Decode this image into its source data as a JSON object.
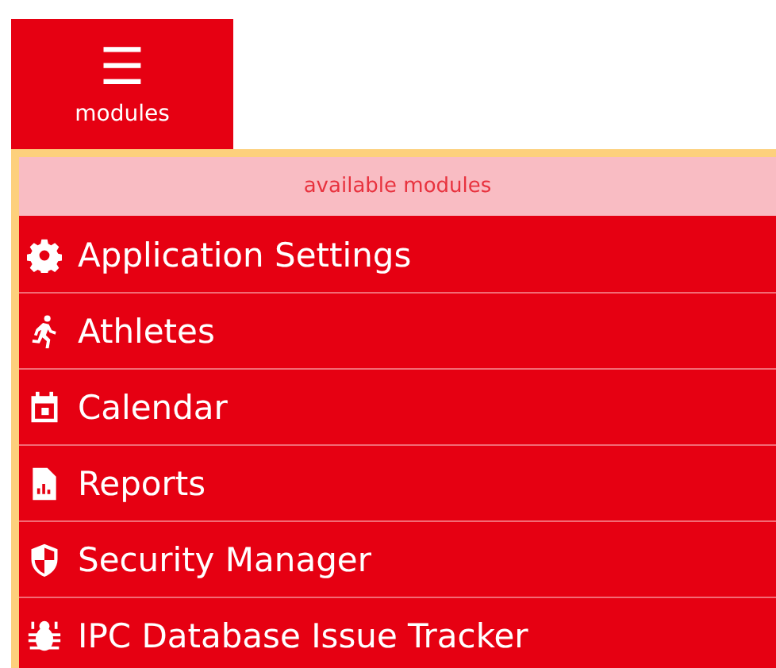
{
  "menu_button": {
    "icon": "☰",
    "label": "modules"
  },
  "panel": {
    "heading": "available modules",
    "items": [
      {
        "label": "Application Settings"
      },
      {
        "label": "Athletes"
      },
      {
        "label": "Calendar"
      },
      {
        "label": "Reports"
      },
      {
        "label": "Security Manager"
      },
      {
        "label": "IPC Database Issue Tracker"
      }
    ]
  }
}
